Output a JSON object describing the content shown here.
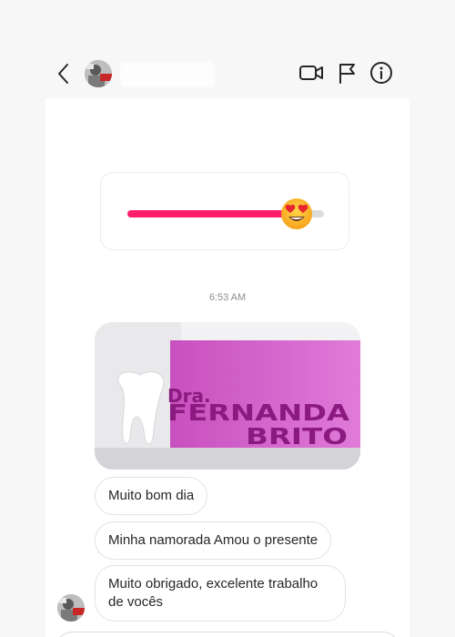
{
  "header": {
    "back_icon": "chevron-left-icon",
    "actions": [
      "video-camera-icon",
      "flag-icon",
      "info-icon"
    ]
  },
  "thread": {
    "slider_sticker": {
      "emoji": "heart-eyes-emoji",
      "value": 0.86,
      "fill_color": "#ff1f6b"
    },
    "timestamp": "6:53 AM",
    "photo": {
      "sign_line1": "Dra.",
      "sign_line2": "FERNANDA",
      "sign_line3": "BRITO"
    },
    "messages": [
      "Muito bom dia",
      "Minha namorada Amou o presente",
      "Muito obrigado, excelente trabalho de vocês"
    ]
  }
}
